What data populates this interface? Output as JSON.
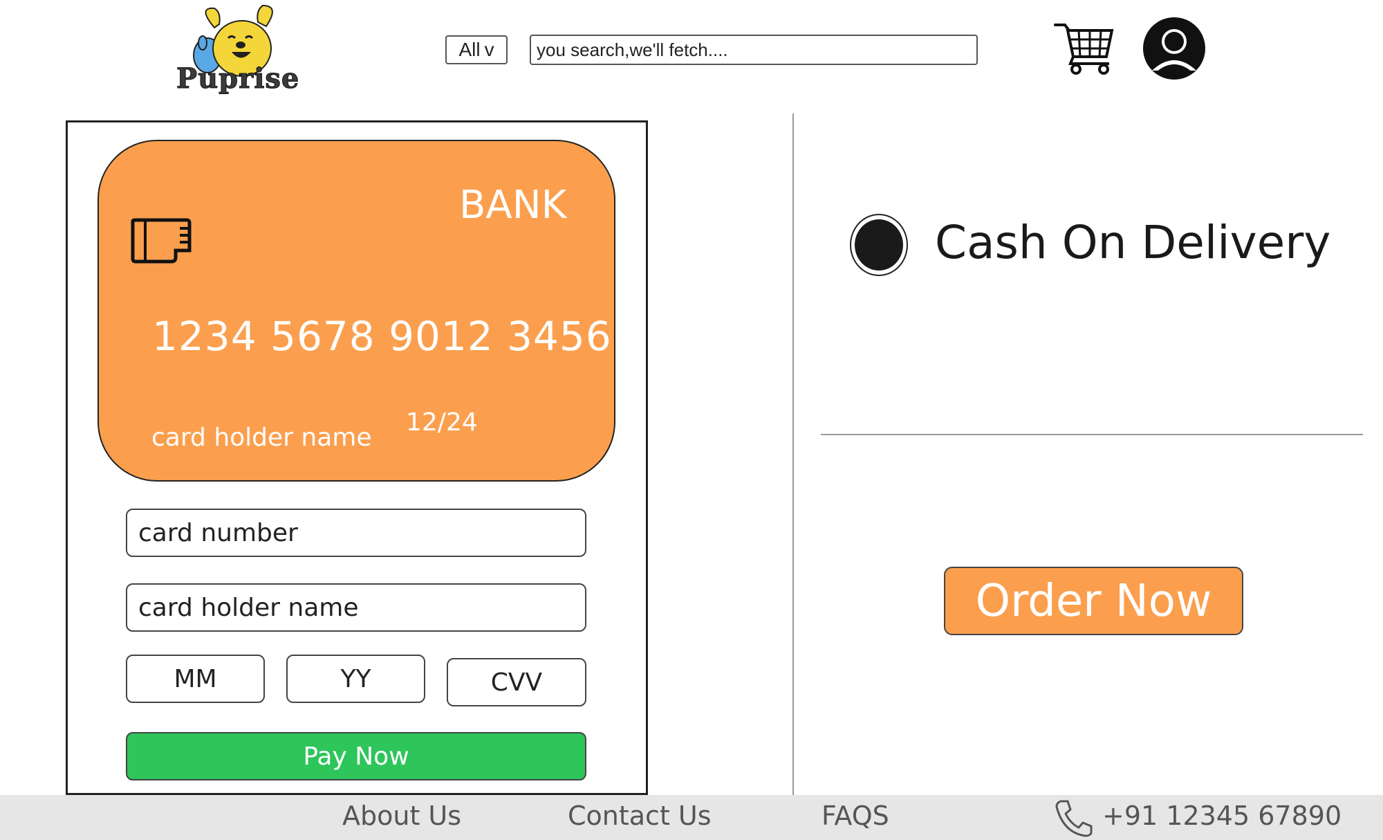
{
  "header": {
    "logo_text": "Puprise",
    "category_select": {
      "selected": "All",
      "arrow": "v"
    },
    "search": {
      "placeholder": "you search,we'll fetch...."
    },
    "icons": {
      "cart": "cart-icon",
      "profile": "profile-icon"
    }
  },
  "card": {
    "bank_label": "BANK",
    "number": "1234 5678 9012 3456",
    "holder_name": "card holder name",
    "expiry": "12/24",
    "color": "#fb9f4e"
  },
  "form": {
    "card_number_placeholder": "card number",
    "card_holder_placeholder": "card holder name",
    "mm_placeholder": "MM",
    "yy_placeholder": "YY",
    "cvv_placeholder": "CVV",
    "pay_button": "Pay Now",
    "pay_button_color": "#2ec55b"
  },
  "right_panel": {
    "cod_label": "Cash On Delivery",
    "cod_selected": true,
    "order_button": "Order Now",
    "order_button_color": "#fb9f4e"
  },
  "footer": {
    "links": [
      "About Us",
      "Contact Us",
      "FAQS"
    ],
    "phone": "+91 12345 67890",
    "phone_icon": "phone-icon"
  }
}
